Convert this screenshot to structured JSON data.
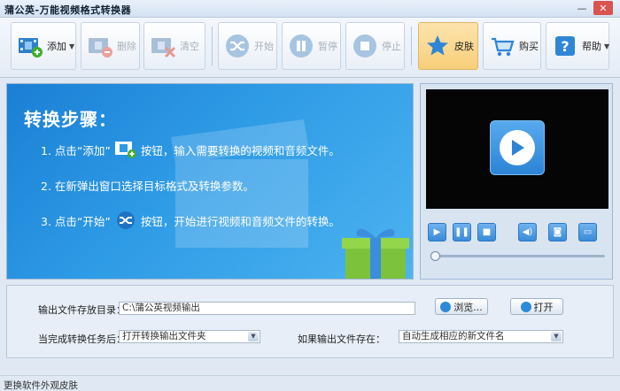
{
  "window": {
    "title": "蒲公英-万能视频格式转换器",
    "minimize_glyph": "—",
    "close_glyph": "✕"
  },
  "toolbar": {
    "add": "添加",
    "delete": "删除",
    "clear": "清空",
    "start": "开始",
    "pause": "暂停",
    "stop": "停止",
    "skin": "皮肤",
    "buy": "购买",
    "help": "帮助"
  },
  "banner": {
    "heading": "转换步骤：",
    "step1_a": "1. 点击“添加”",
    "step1_b": "按钮，输入需要转换的视频和音频文件。",
    "step2": "2. 在新弹出窗口选择目标格式及转换参数。",
    "step3_a": "3. 点击“开始”",
    "step3_b": "按钮，开始进行视频和音频文件的转换。"
  },
  "player": {
    "controls": [
      "play-icon",
      "pause-icon",
      "stop-icon",
      "volume-icon",
      "snapshot-icon",
      "fullscreen-icon"
    ],
    "progress": 0
  },
  "settings": {
    "output_dir_label": "输出文件存放目录：",
    "output_dir_value": "C:\\蒲公英视频输出",
    "browse": "浏览...",
    "open": "打开",
    "after_label": "当完成转换任务后：",
    "after_value": "打开转换输出文件夹",
    "exists_label": "如果输出文件存在：",
    "exists_value": "自动生成相应的新文件名"
  },
  "status": {
    "text": "更换软件外观皮肤"
  },
  "colors": {
    "banner_blue": "#2e9be6",
    "skin_active": "#f7cf79",
    "accent": "#2d8ad8"
  }
}
